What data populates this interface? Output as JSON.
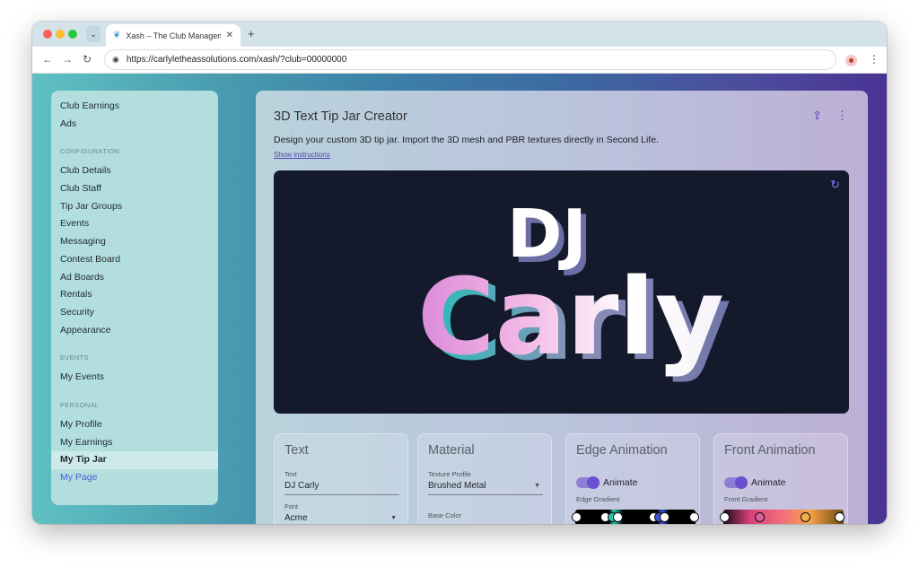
{
  "browser": {
    "tab_title": "Xash – The Club Management",
    "url": "https://carlyletheassolutions.com/xash/?club=00000000"
  },
  "sidebar": {
    "top_items": [
      "Club Earnings",
      "Ads"
    ],
    "sections": [
      {
        "title": "CONFIGURATION",
        "items": [
          "Club Details",
          "Club Staff",
          "Tip Jar Groups",
          "Events",
          "Messaging",
          "Contest Board",
          "Ad Boards",
          "Rentals",
          "Security",
          "Appearance"
        ]
      },
      {
        "title": "EVENTS",
        "items": [
          "My Events"
        ]
      },
      {
        "title": "PERSONAL",
        "items": [
          "My Profile",
          "My Earnings",
          "My Tip Jar",
          "My Page"
        ]
      }
    ],
    "active_item": "My Tip Jar"
  },
  "main": {
    "title": "3D Text Tip Jar Creator",
    "description": "Design your custom 3D tip jar. Import the 3D mesh and PBR textures directly in Second Life.",
    "instructions_link": "Show instructions",
    "preview": {
      "line1": "DJ",
      "line2": "Carly"
    }
  },
  "panels": {
    "text": {
      "title": "Text",
      "text_label": "Text",
      "text_value": "DJ Carly",
      "font_label": "Font",
      "font_value": "Acme"
    },
    "material": {
      "title": "Material",
      "texture_label": "Texture Profile",
      "texture_value": "Brushed Metal",
      "base_color_label": "Base Color"
    },
    "edge": {
      "title": "Edge Animation",
      "animate_label": "Animate",
      "gradient_label": "Edge Gradient"
    },
    "front": {
      "title": "Front Animation",
      "animate_label": "Animate",
      "gradient_label": "Front Gradient"
    }
  },
  "colors": {
    "accent": "#6a4fd0",
    "preview_bg": "#141a2b"
  }
}
